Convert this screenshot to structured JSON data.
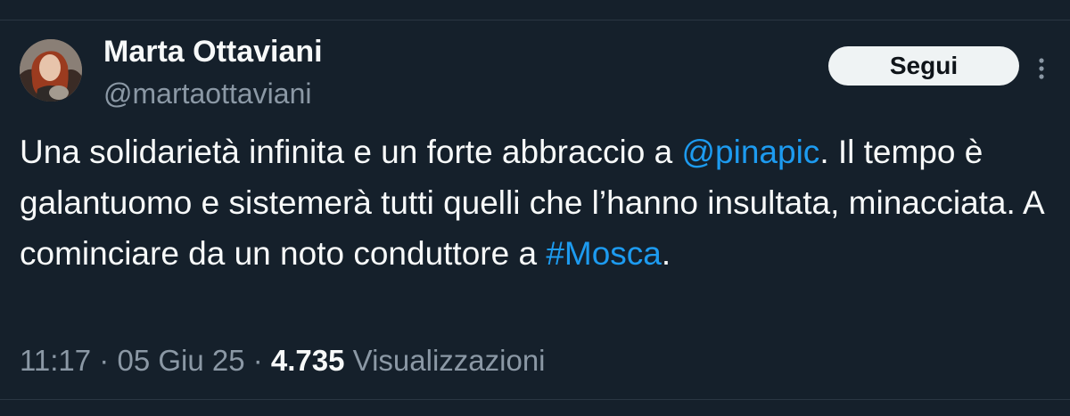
{
  "author": {
    "name": "Marta Ottaviani",
    "handle": "@martaottaviani"
  },
  "actions": {
    "follow_label": "Segui",
    "more_icon": "more-vertical-icon"
  },
  "tweet": {
    "segment_1": "Una solidarietà infinita e un forte abbraccio a ",
    "mention": "@pinapic",
    "segment_2": ". Il tempo è galantuomo e sistemerà tutti quelli che l’hanno insultata, minacciata. A cominciare da un noto conduttore a ",
    "hashtag": "#Mosca",
    "segment_3": "."
  },
  "meta": {
    "time": "11:17",
    "separator": " · ",
    "date": "05 Giu 25",
    "views_count": "4.735",
    "views_label": " Visualizzazioni"
  },
  "colors": {
    "background": "#15202b",
    "text": "#f7f9f9",
    "secondary": "#8b98a5",
    "link": "#1d9bf0",
    "button_bg": "#eff3f4"
  }
}
